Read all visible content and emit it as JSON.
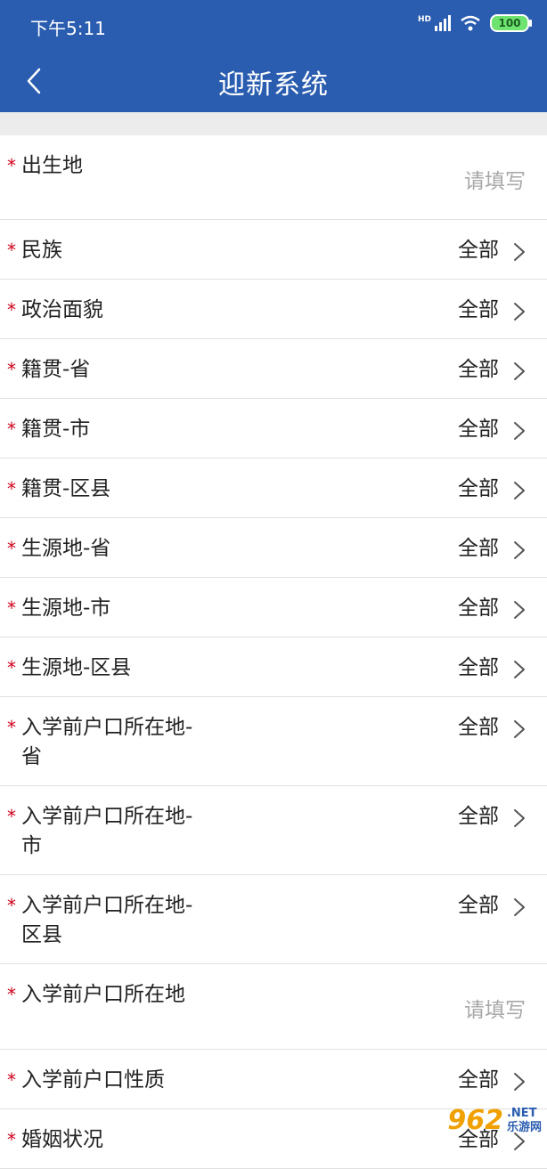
{
  "status_bar": {
    "time": "下午5:11",
    "hd_label": "HD",
    "battery": "100"
  },
  "nav": {
    "title": "迎新系统"
  },
  "form": {
    "rows": [
      {
        "label": "出生地",
        "type": "input",
        "placeholder": "请填写"
      },
      {
        "label": "民族",
        "type": "select",
        "value": "全部"
      },
      {
        "label": "政治面貌",
        "type": "select",
        "value": "全部"
      },
      {
        "label": "籍贯-省",
        "type": "select",
        "value": "全部"
      },
      {
        "label": "籍贯-市",
        "type": "select",
        "value": "全部"
      },
      {
        "label": "籍贯-区县",
        "type": "select",
        "value": "全部"
      },
      {
        "label": "生源地-省",
        "type": "select",
        "value": "全部"
      },
      {
        "label": "生源地-市",
        "type": "select",
        "value": "全部"
      },
      {
        "label": "生源地-区县",
        "type": "select",
        "value": "全部"
      },
      {
        "label": "入学前户口所在地-\n省",
        "type": "select",
        "value": "全部"
      },
      {
        "label": "入学前户口所在地-\n市",
        "type": "select",
        "value": "全部"
      },
      {
        "label": "入学前户口所在地-\n区县",
        "type": "select",
        "value": "全部"
      },
      {
        "label": "入学前户口所在地",
        "type": "input",
        "placeholder": "请填写"
      },
      {
        "label": "入学前户口性质",
        "type": "select",
        "value": "全部"
      },
      {
        "label": "婚姻状况",
        "type": "select",
        "value": "全部"
      }
    ],
    "required_mark": "*"
  },
  "watermark": {
    "logo": "962",
    "suffix": ".NET",
    "site": "乐游网"
  }
}
